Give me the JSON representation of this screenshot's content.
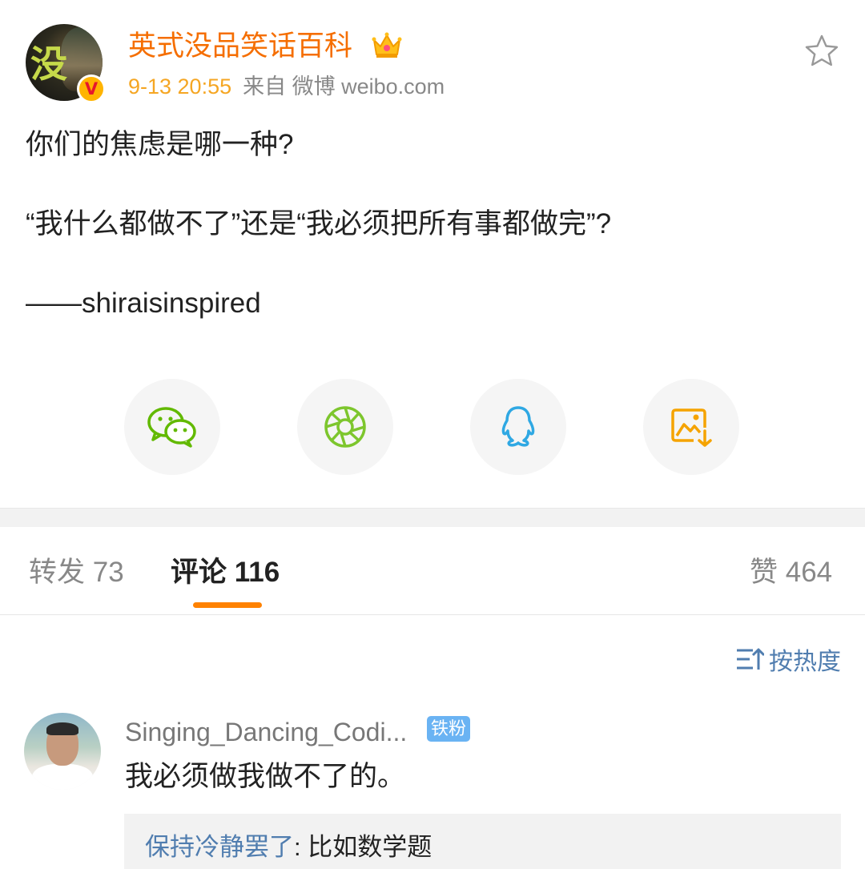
{
  "post": {
    "user_name": "英式没品笑话百科",
    "time": "9-13 20:55",
    "source": "来自 微博 weibo.com",
    "lines": [
      "你们的焦虑是哪一种?",
      "“我什么都做不了”还是“我必须把所有事都做完”?",
      "——shiraisinspired"
    ],
    "avatar_text": "没"
  },
  "share": [
    {
      "icon": "wechat-icon"
    },
    {
      "icon": "moments-icon"
    },
    {
      "icon": "qq-icon"
    },
    {
      "icon": "save-image-icon"
    }
  ],
  "tabs": {
    "repost": "转发 73",
    "comment": "评论 116",
    "like": "赞 464"
  },
  "sort_label": "按热度",
  "comment": {
    "user": "Singing_Dancing_Codi...",
    "badge": "铁粉",
    "text": "我必须做我做不了的。",
    "reply_user": "保持冷静罢了",
    "reply_sep": ": ",
    "reply_text": "比如数学题"
  },
  "colors": {
    "name_orange": "#f56e00",
    "time_orange": "#f5a623",
    "accent": "#ff8200",
    "link_blue": "#507daf",
    "wechat_green": "#62b900",
    "moments_green": "#7dc62d",
    "qq_blue": "#2fa8e3",
    "save_orange": "#f5a300"
  }
}
